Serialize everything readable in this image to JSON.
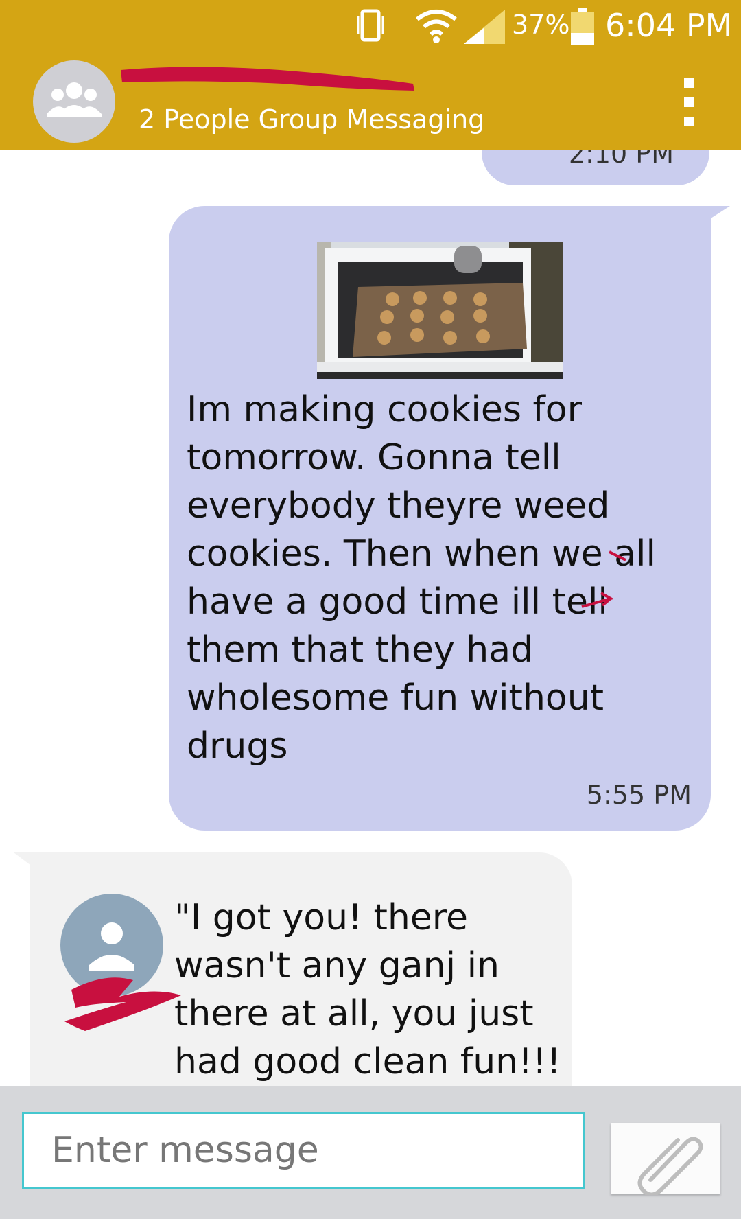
{
  "status_bar": {
    "battery_percent": "37%",
    "time": "6:04 PM"
  },
  "header": {
    "contact_name": "",
    "subtitle": "2 People Group Messaging",
    "menu_icon": "overflow-menu-icon",
    "avatar_icon": "group-people-icon"
  },
  "messages": [
    {
      "direction": "outgoing",
      "time": "2:10 PM"
    },
    {
      "direction": "outgoing",
      "has_image": true,
      "text": "Im making cookies for tomorrow. Gonna tell everybody theyre weed cookies. Then when we all have a good time ill tell them that they had wholesome fun without drugs",
      "time": "5:55 PM"
    },
    {
      "direction": "incoming",
      "text": "\"I got you! there wasn't any ganj in there at all, you just had good clean fun!!!"
    }
  ],
  "composer": {
    "placeholder": "Enter message",
    "attach_icon": "paperclip-icon"
  },
  "colors": {
    "header": "#d4a514",
    "outgoing_bubble": "#cacdee",
    "incoming_bubble": "#f2f2f2",
    "redaction": "#c8103f",
    "input_border": "#45c7cf"
  }
}
